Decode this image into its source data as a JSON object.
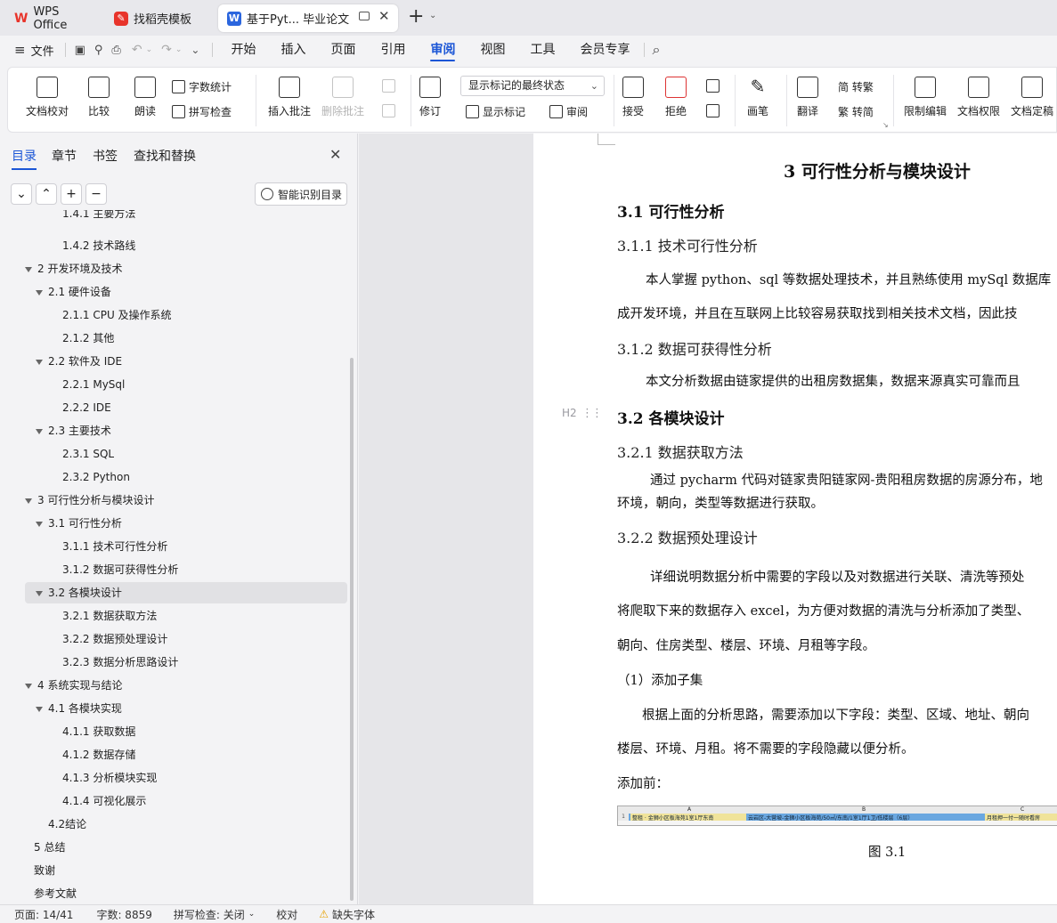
{
  "tabs": [
    {
      "label": "WPS Office",
      "icon": "wps-logo-icon"
    },
    {
      "label": "找稻壳模板",
      "icon": "docer-icon"
    },
    {
      "label": "基于Pyt... 毕业论文",
      "icon": "word-doc-icon"
    }
  ],
  "menu": {
    "file_label": "文件",
    "items": [
      "开始",
      "插入",
      "页面",
      "引用",
      "审阅",
      "视图",
      "工具",
      "会员专享"
    ],
    "active": "审阅"
  },
  "ribbon": {
    "doc_check": "文档校对",
    "compare": "比较",
    "read_aloud": "朗读",
    "word_count": "字数统计",
    "spell_check": "拼写检查",
    "insert_comment": "插入批注",
    "delete_comment": "删除批注",
    "revise": "修订",
    "display_select": "显示标记的最终状态",
    "show_markup": "显示标记",
    "review_pane": "审阅",
    "accept": "接受",
    "reject": "拒绝",
    "pen": "画笔",
    "translate": "翻译",
    "simp_to_trad": "简 转繁",
    "trad_to_simp": "繁 转简",
    "restrict_edit": "限制编辑",
    "doc_permission": "文档权限",
    "doc_finalize": "文档定稿"
  },
  "panel": {
    "tabs": [
      "目录",
      "章节",
      "书签",
      "查找和替换"
    ],
    "active_tab": "目录",
    "smart_button": "智能识别目录",
    "toc": [
      {
        "label": "1.4.1 主要方法",
        "level": 3
      },
      {
        "label": "1.4.2 技术路线",
        "level": 3
      },
      {
        "label": "2 开发环境及技术",
        "level": 1,
        "expanded": true
      },
      {
        "label": "2.1 硬件设备",
        "level": 2,
        "expanded": true
      },
      {
        "label": "2.1.1 CPU 及操作系统",
        "level": 3
      },
      {
        "label": "2.1.2  其他",
        "level": 3
      },
      {
        "label": "2.2 软件及 IDE",
        "level": 2,
        "expanded": true
      },
      {
        "label": "2.2.1 MySql",
        "level": 3
      },
      {
        "label": "2.2.2 IDE",
        "level": 3
      },
      {
        "label": "2.3 主要技术",
        "level": 2,
        "expanded": true
      },
      {
        "label": "2.3.1 SQL",
        "level": 3
      },
      {
        "label": "2.3.2 Python",
        "level": 3
      },
      {
        "label": "3  可行性分析与模块设计",
        "level": 1,
        "expanded": true
      },
      {
        "label": "3.1  可行性分析",
        "level": 2,
        "expanded": true
      },
      {
        "label": "3.1.1  技术可行性分析",
        "level": 3
      },
      {
        "label": "3.1.2  数据可获得性分析",
        "level": 3
      },
      {
        "label": "3.2  各模块设计",
        "level": 2,
        "expanded": true,
        "selected": true
      },
      {
        "label": "3.2.1  数据获取方法",
        "level": 3
      },
      {
        "label": "3.2.2  数据预处理设计",
        "level": 3
      },
      {
        "label": "3.2.3  数据分析思路设计",
        "level": 3
      },
      {
        "label": "4  系统实现与结论",
        "level": 1,
        "expanded": true
      },
      {
        "label": "4.1  各模块实现",
        "level": 2,
        "expanded": true
      },
      {
        "label": "4.1.1  获取数据",
        "level": 3
      },
      {
        "label": "4.1.2  数据存储",
        "level": 3
      },
      {
        "label": "4.1.3  分析模块实现",
        "level": 3
      },
      {
        "label": "4.1.4  可视化展示",
        "level": 3
      },
      {
        "label": "4.2结论",
        "level": 2
      },
      {
        "label": "5 总结",
        "level": 1
      },
      {
        "label": "致谢",
        "level": 1
      },
      {
        "label": "参考文献",
        "level": 1
      }
    ]
  },
  "document": {
    "chapter_title": "3  可行性分析与模块设计",
    "h_3_1": "3.1  可行性分析",
    "h_3_1_1": "3.1.1  技术可行性分析",
    "p1a": "本人掌握 python、sql 等数据处理技术，并且熟练使用 mySql 数据库",
    "p1b": "成开发环境，并且在互联网上比较容易获取找到相关技术文档，因此技",
    "h_3_1_2": "3.1.2  数据可获得性分析",
    "p2": "本文分析数据由链家提供的出租房数据集，数据来源真实可靠而且",
    "heading_marker": "H2",
    "h_3_2": "3.2  各模块设计",
    "h_3_2_1": "3.2.1  数据获取方法",
    "p3a": "通过 pycharm 代码对链家贵阳链家网-贵阳租房数据的房源分布，地",
    "p3b": "环境，朝向，类型等数据进行获取。",
    "h_3_2_2": "3.2.2  数据预处理设计",
    "p4a": "详细说明数据分析中需要的字段以及对数据进行关联、清洗等预处",
    "p4b": "将爬取下来的数据存入 excel，为方便对数据的清洗与分析添加了类型、",
    "p4c": "朝向、住房类型、楼层、环境、月租等字段。",
    "sub1": "（1）添加子集",
    "p5a": "根据上面的分析思路，需要添加以下字段：类型、区域、地址、朝向",
    "p5b": "楼层、环境、月租。将不需要的字段隐藏以便分析。",
    "before_label": "添加前：",
    "fig_col_a": "A",
    "fig_col_b": "B",
    "fig_col_c": "C",
    "fig_row1_a": "整租 · 金狮小区板海苑1室1厅东南",
    "fig_row1_b": "云岩区-大营坡-金狮小区板海苑/50㎡/东南/1室1厅1卫/低楼层（6层）",
    "fig_row1_c": "月租押一付一随时看房",
    "fig_caption": "图 3.1"
  },
  "status": {
    "page": "页面: 14/41",
    "words": "字数: 8859",
    "spell": "拼写检查: 关闭",
    "proof": "校对",
    "missing_font": "缺失字体"
  },
  "colors": {
    "accent": "#1b56d6",
    "wps_red": "#e8342b"
  }
}
